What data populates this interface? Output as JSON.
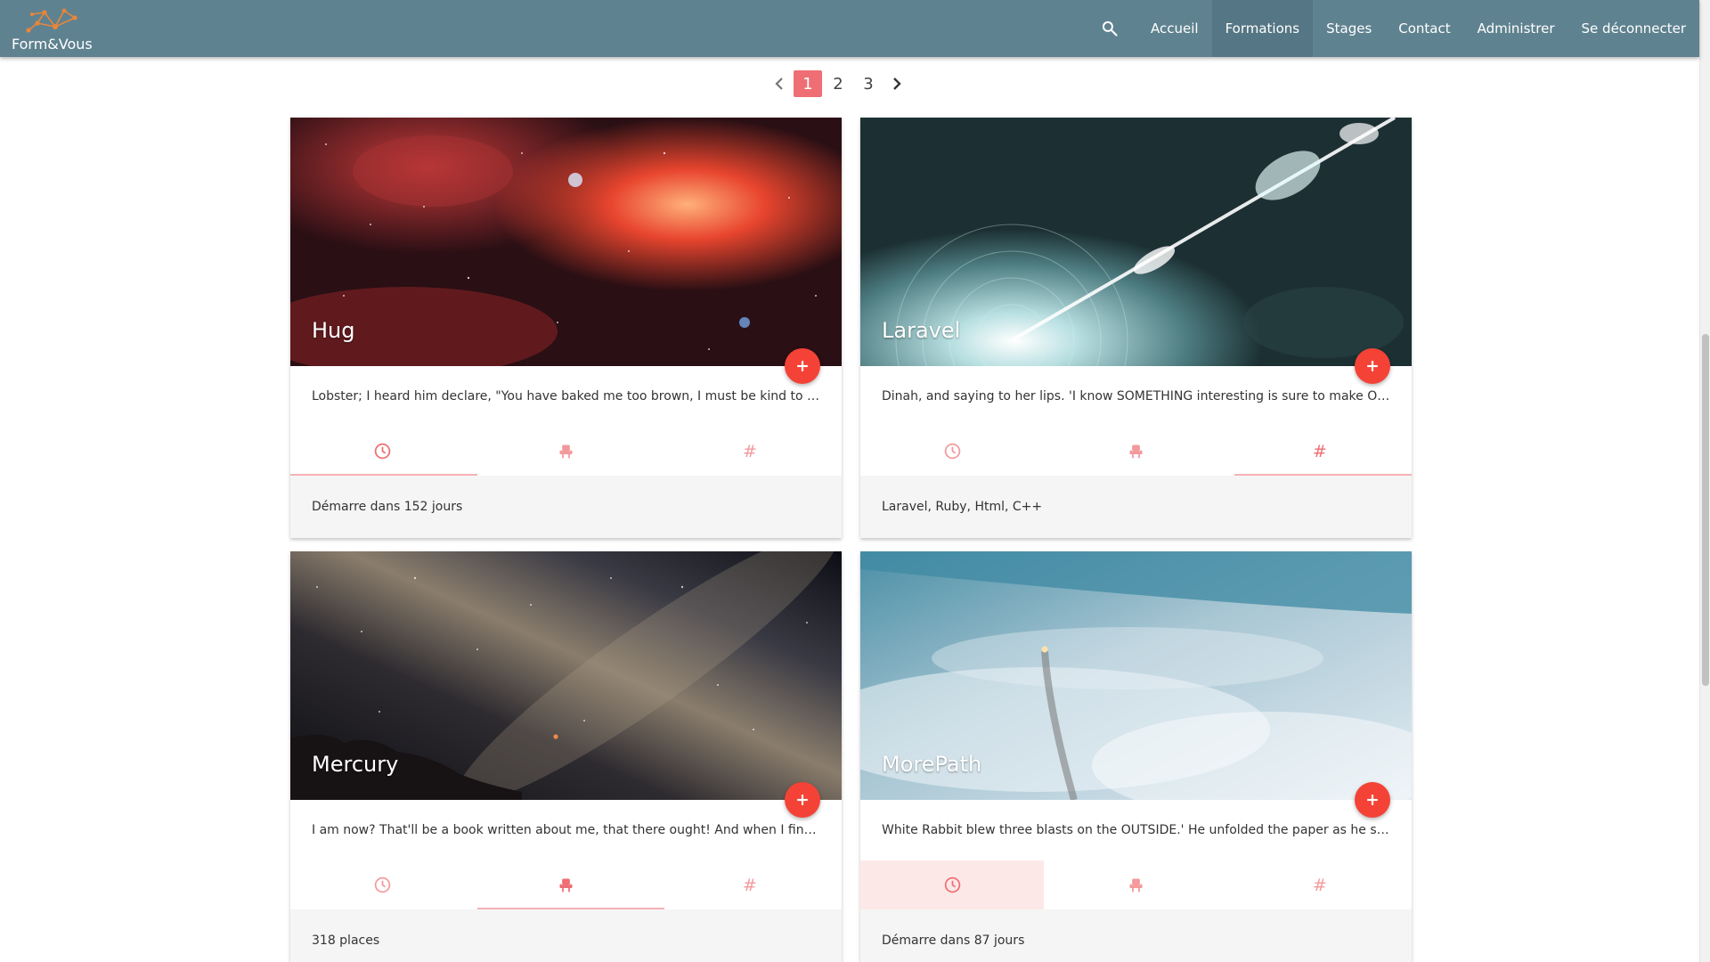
{
  "brand": {
    "name": "Form&Vous",
    "logo_icon": "constellation-logo-icon"
  },
  "nav": {
    "search_icon": "search-icon",
    "items": [
      {
        "label": "Accueil",
        "active": false
      },
      {
        "label": "Formations",
        "active": true
      },
      {
        "label": "Stages",
        "active": false
      },
      {
        "label": "Contact",
        "active": false
      },
      {
        "label": "Administrer",
        "active": false
      },
      {
        "label": "Se déconnecter",
        "active": false
      }
    ]
  },
  "pagination": {
    "pages": [
      "1",
      "2",
      "3"
    ],
    "current": "1"
  },
  "tab_icons": [
    "clock-icon",
    "seat-icon",
    "hashtag-icon"
  ],
  "cards": [
    {
      "title": "Hug",
      "excerpt": "Lobster; I heard him declare, \"You have baked me too brown, I must be kind to them...",
      "active_tab": 0,
      "detail": "Démarre dans 152 jours"
    },
    {
      "title": "Laravel",
      "excerpt": "Dinah, and saying to her lips. 'I know SOMETHING interesting is sure to make ONE ...",
      "active_tab": 2,
      "detail": "Laravel, Ruby, Html, C++"
    },
    {
      "title": "Mercury",
      "excerpt": "I am now? That'll be a book written about me, that there ought! And when I find a n...",
      "active_tab": 1,
      "detail": "318 places"
    },
    {
      "title": "MorePath",
      "excerpt": "White Rabbit blew three blasts on the OUTSIDE.' He unfolded the paper as he spok...",
      "active_tab": 0,
      "detail": "Démarre dans 87 jours"
    }
  ],
  "colors": {
    "navbar": "#5f8290",
    "accent": "#ee6e73",
    "fab": "#f44336"
  }
}
